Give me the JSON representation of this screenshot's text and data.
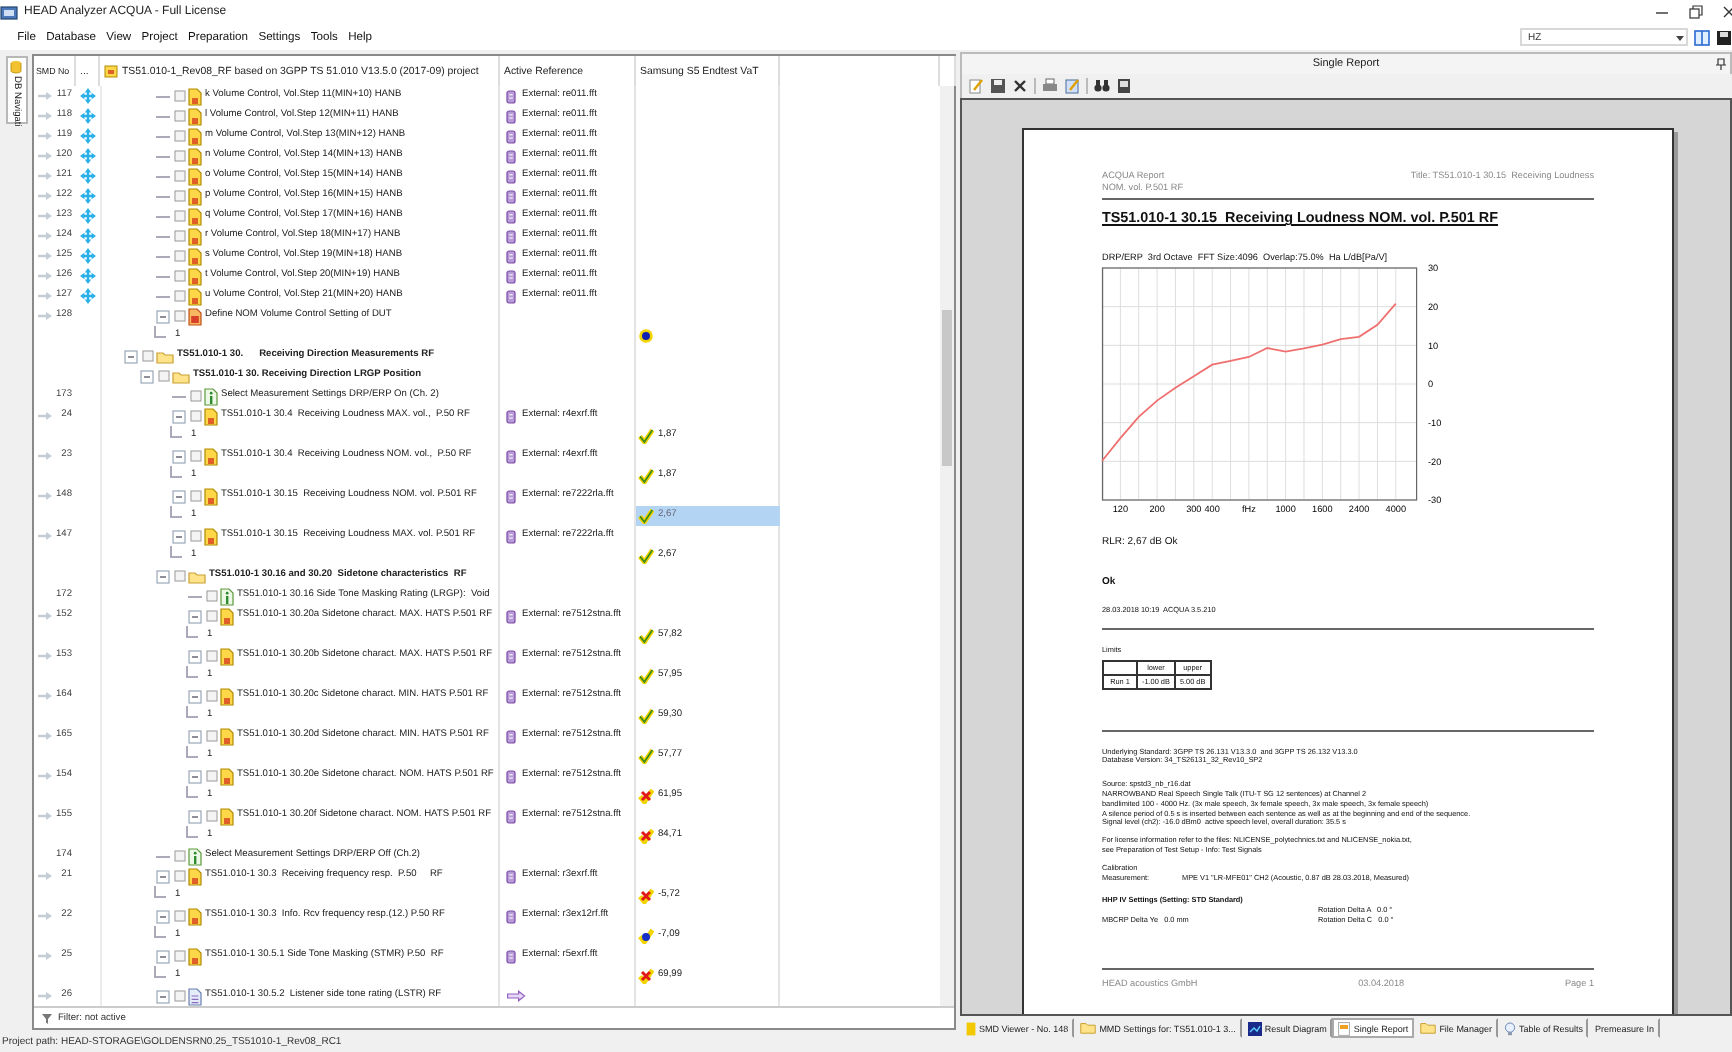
{
  "window": {
    "title": "HEAD Analyzer ACQUA - Full License"
  },
  "menu": [
    "File",
    "Database",
    "View",
    "Project",
    "Preparation",
    "Settings",
    "Tools",
    "Help"
  ],
  "unit_dropdown": {
    "value": "HZ"
  },
  "navigator": {
    "side_tab": "DB Navigati",
    "columns": [
      "SMD No",
      "...",
      "TS51.010-1_Rev08_RF based on 3GPP TS 51.010 V13.5.0 (2017-09) project",
      "Active Reference",
      "Samsung S5 Endtest VaT"
    ],
    "tree": [
      {
        "kind": "group",
        "children": [
          {
            "kind": "measurement",
            "smd": "117",
            "pointer": true,
            "flag": true,
            "checked": false,
            "label": "k Volume Control, Vol.Step 11(MIN+10) HANB",
            "reference": {
              "kind": "external",
              "text": "External: re011.fft"
            }
          },
          {
            "kind": "measurement",
            "smd": "118",
            "pointer": true,
            "flag": true,
            "checked": false,
            "label": "l Volume Control, Vol.Step 12(MIN+11) HANB",
            "reference": {
              "kind": "external",
              "text": "External: re011.fft"
            }
          },
          {
            "kind": "measurement",
            "smd": "119",
            "pointer": true,
            "flag": true,
            "checked": false,
            "label": "m Volume Control, Vol.Step 13(MIN+12) HANB",
            "reference": {
              "kind": "external",
              "text": "External: re011.fft"
            }
          },
          {
            "kind": "measurement",
            "smd": "120",
            "pointer": true,
            "flag": true,
            "checked": false,
            "label": "n Volume Control, Vol.Step 14(MIN+13) HANB",
            "reference": {
              "kind": "external",
              "text": "External: re011.fft"
            }
          },
          {
            "kind": "measurement",
            "smd": "121",
            "pointer": true,
            "flag": true,
            "checked": false,
            "label": "o Volume Control, Vol.Step 15(MIN+14) HANB",
            "reference": {
              "kind": "external",
              "text": "External: re011.fft"
            }
          },
          {
            "kind": "measurement",
            "smd": "122",
            "pointer": true,
            "flag": true,
            "checked": false,
            "label": "p Volume Control, Vol.Step 16(MIN+15) HANB",
            "reference": {
              "kind": "external",
              "text": "External: re011.fft"
            }
          },
          {
            "kind": "measurement",
            "smd": "123",
            "pointer": true,
            "flag": true,
            "checked": false,
            "label": "q Volume Control, Vol.Step 17(MIN+16) HANB",
            "reference": {
              "kind": "external",
              "text": "External: re011.fft"
            }
          },
          {
            "kind": "measurement",
            "smd": "124",
            "pointer": true,
            "flag": true,
            "checked": false,
            "label": "r Volume Control, Vol.Step 18(MIN+17) HANB",
            "reference": {
              "kind": "external",
              "text": "External: re011.fft"
            }
          },
          {
            "kind": "measurement",
            "smd": "125",
            "pointer": true,
            "flag": true,
            "checked": false,
            "label": "s Volume Control, Vol.Step 19(MIN+18) HANB",
            "reference": {
              "kind": "external",
              "text": "External: re011.fft"
            }
          },
          {
            "kind": "measurement",
            "smd": "126",
            "pointer": true,
            "flag": true,
            "checked": false,
            "label": "t Volume Control, Vol.Step 20(MIN+19) HANB",
            "reference": {
              "kind": "external",
              "text": "External: re011.fft"
            }
          },
          {
            "kind": "measurement",
            "smd": "127",
            "pointer": true,
            "flag": true,
            "checked": false,
            "label": "u Volume Control, Vol.Step 21(MIN+20) HANB",
            "reference": {
              "kind": "external",
              "text": "External: re011.fft"
            }
          },
          {
            "kind": "setup",
            "smd": "128",
            "pointer": true,
            "flag": false,
            "checked": false,
            "expanded": true,
            "label": "Define NOM Volume Control Setting of DUT",
            "children": [
              {
                "kind": "run",
                "label": "1",
                "selected": false,
                "result": {
                  "kind": "dot"
                }
              }
            ]
          }
        ]
      },
      {
        "kind": "folder",
        "expanded": true,
        "checked": false,
        "label": "TS51.010-1 30.      Receiving Direction Measurements RF",
        "children": [
          {
            "kind": "folder",
            "expanded": true,
            "checked": false,
            "label": "TS51.010-1 30. Receiving Direction LRGP Position",
            "children": [
              {
                "kind": "info",
                "smd": "173",
                "pointer": false,
                "flag": false,
                "checked": false,
                "label": "Select Measurement Settings DRP/ERP On (Ch. 2)"
              },
              {
                "kind": "measurement",
                "smd": "24",
                "pointer": true,
                "flag": false,
                "checked": false,
                "expanded": true,
                "label": "TS51.010-1 30.4  Receiving Loudness MAX. vol.,  P.50 RF",
                "reference": {
                  "kind": "external",
                  "text": "External: r4exrf.fft"
                },
                "children": [
                  {
                    "kind": "run",
                    "label": "1",
                    "selected": false,
                    "result": {
                      "kind": "pass",
                      "value": "1,87"
                    }
                  }
                ]
              },
              {
                "kind": "measurement",
                "smd": "23",
                "pointer": true,
                "flag": false,
                "checked": false,
                "expanded": true,
                "label": "TS51.010-1 30.4  Receiving Loudness NOM. vol.,  P.50 RF",
                "reference": {
                  "kind": "external",
                  "text": "External: r4exrf.fft"
                },
                "children": [
                  {
                    "kind": "run",
                    "label": "1",
                    "selected": false,
                    "result": {
                      "kind": "pass",
                      "value": "1,87"
                    }
                  }
                ]
              },
              {
                "kind": "measurement",
                "smd": "148",
                "pointer": true,
                "flag": false,
                "checked": false,
                "expanded": true,
                "label": "TS51.010-1 30.15  Receiving Loudness NOM. vol. P.501 RF",
                "reference": {
                  "kind": "external",
                  "text": "External: re7222rla.fft"
                },
                "children": [
                  {
                    "kind": "run",
                    "label": "1",
                    "selected": true,
                    "result": {
                      "kind": "pass",
                      "value": "2,67"
                    }
                  }
                ]
              },
              {
                "kind": "measurement",
                "smd": "147",
                "pointer": true,
                "flag": false,
                "checked": false,
                "expanded": true,
                "label": "TS51.010-1 30.15  Receiving Loudness MAX. vol. P.501 RF",
                "reference": {
                  "kind": "external",
                  "text": "External: re7222rla.fft"
                },
                "children": [
                  {
                    "kind": "run",
                    "label": "1",
                    "selected": false,
                    "result": {
                      "kind": "pass",
                      "value": "2,67"
                    }
                  }
                ]
              },
              {
                "kind": "folder",
                "expanded": true,
                "checked": false,
                "label": "TS51.010-1 30.16 and 30.20  Sidetone characteristics  RF",
                "children": [
                  {
                    "kind": "info",
                    "smd": "172",
                    "pointer": false,
                    "flag": false,
                    "checked": false,
                    "label": "TS51.010-1 30.16 Side Tone Masking Rating (LRGP):  Void"
                  },
                  {
                    "kind": "measurement",
                    "smd": "152",
                    "pointer": true,
                    "flag": false,
                    "checked": false,
                    "expanded": true,
                    "label": "TS51.010-1 30.20a Sidetone charact. MAX. HATS P.501 RF",
                    "reference": {
                      "kind": "external",
                      "text": "External: re7512stna.fft"
                    },
                    "children": [
                      {
                        "kind": "run",
                        "label": "1",
                        "selected": false,
                        "result": {
                          "kind": "pass",
                          "value": "57,82"
                        }
                      }
                    ]
                  },
                  {
                    "kind": "measurement",
                    "smd": "153",
                    "pointer": true,
                    "flag": false,
                    "checked": false,
                    "expanded": true,
                    "label": "TS51.010-1 30.20b Sidetone charact. MAX. HATS P.501 RF",
                    "reference": {
                      "kind": "external",
                      "text": "External: re7512stna.fft"
                    },
                    "children": [
                      {
                        "kind": "run",
                        "label": "1",
                        "selected": false,
                        "result": {
                          "kind": "pass",
                          "value": "57,95"
                        }
                      }
                    ]
                  },
                  {
                    "kind": "measurement",
                    "smd": "164",
                    "pointer": true,
                    "flag": false,
                    "checked": false,
                    "expanded": true,
                    "label": "TS51.010-1 30.20c Sidetone charact. MIN. HATS P.501 RF",
                    "reference": {
                      "kind": "external",
                      "text": "External: re7512stna.fft"
                    },
                    "children": [
                      {
                        "kind": "run",
                        "label": "1",
                        "selected": false,
                        "result": {
                          "kind": "pass",
                          "value": "59,30"
                        }
                      }
                    ]
                  },
                  {
                    "kind": "measurement",
                    "smd": "165",
                    "pointer": true,
                    "flag": false,
                    "checked": false,
                    "expanded": true,
                    "label": "TS51.010-1 30.20d Sidetone charact. MIN. HATS P.501 RF",
                    "reference": {
                      "kind": "external",
                      "text": "External: re7512stna.fft"
                    },
                    "children": [
                      {
                        "kind": "run",
                        "label": "1",
                        "selected": false,
                        "result": {
                          "kind": "pass",
                          "value": "57,77"
                        }
                      }
                    ]
                  },
                  {
                    "kind": "measurement",
                    "smd": "154",
                    "pointer": true,
                    "flag": false,
                    "checked": false,
                    "expanded": true,
                    "label": "TS51.010-1 30.20e Sidetone charact. NOM. HATS P.501 RF",
                    "reference": {
                      "kind": "external",
                      "text": "External: re7512stna.fft"
                    },
                    "children": [
                      {
                        "kind": "run",
                        "label": "1",
                        "selected": false,
                        "result": {
                          "kind": "fail",
                          "value": "61,95"
                        }
                      }
                    ]
                  },
                  {
                    "kind": "measurement",
                    "smd": "155",
                    "pointer": true,
                    "flag": false,
                    "checked": false,
                    "expanded": true,
                    "label": "TS51.010-1 30.20f Sidetone charact. NOM. HATS P.501 RF",
                    "reference": {
                      "kind": "external",
                      "text": "External: re7512stna.fft"
                    },
                    "children": [
                      {
                        "kind": "run",
                        "label": "1",
                        "selected": false,
                        "result": {
                          "kind": "fail",
                          "value": "84,71"
                        }
                      }
                    ]
                  }
                ]
              }
            ]
          },
          {
            "kind": "info",
            "smd": "174",
            "pointer": false,
            "flag": false,
            "checked": false,
            "label": "Select Measurement Settings DRP/ERP Off (Ch.2)"
          },
          {
            "kind": "measurement",
            "smd": "21",
            "pointer": true,
            "flag": false,
            "checked": false,
            "expanded": true,
            "label": "TS51.010-1 30.3  Receiving frequency resp.  P.50     RF",
            "reference": {
              "kind": "external",
              "text": "External: r3exrf.fft"
            },
            "children": [
              {
                "kind": "run",
                "label": "1",
                "selected": false,
                "result": {
                  "kind": "fail",
                  "value": "-5,72"
                }
              }
            ]
          },
          {
            "kind": "measurement",
            "smd": "22",
            "pointer": true,
            "flag": false,
            "checked": false,
            "expanded": true,
            "label": "TS51.010-1 30.3  Info. Rcv frequency resp.(12.) P.50 RF",
            "reference": {
              "kind": "external",
              "text": "External: r3ex12rf.fft"
            },
            "children": [
              {
                "kind": "run",
                "label": "1",
                "selected": false,
                "result": {
                  "kind": "info",
                  "value": "-7,09"
                }
              }
            ]
          },
          {
            "kind": "measurement",
            "smd": "25",
            "pointer": true,
            "flag": false,
            "checked": false,
            "expanded": true,
            "label": "TS51.010-1 30.5.1 Side Tone Masking (STMR) P.50  RF",
            "reference": {
              "kind": "external",
              "text": "External: r5exrf.fft"
            },
            "children": [
              {
                "kind": "run",
                "label": "1",
                "selected": false,
                "result": {
                  "kind": "fail",
                  "value": "69,99"
                }
              }
            ]
          },
          {
            "kind": "document",
            "smd": "26",
            "pointer": true,
            "flag": false,
            "checked": false,
            "expanded": true,
            "label": "TS51.010-1 30.5.2  Listener side tone rating (LSTR) RF",
            "reference": {
              "kind": "link"
            }
          }
        ]
      }
    ],
    "filter": "Filter: not active"
  },
  "status_bar": "Project path: HEAD-STORAGE\\GOLDENSRN0.25_TS51010-1_Rev08_RC1",
  "report_panel": {
    "title": "Single Report",
    "page": {
      "header_left": [
        "ACQUA Report",
        "NOM. vol. P.501 RF"
      ],
      "header_right": "Title: TS51.010-1 30.15  Receiving Loudness",
      "title": "TS51.010-1 30.15  Receiving Loudness NOM. vol. P.501 RF",
      "chart_data": {
        "type": "line",
        "title": "DRP/ERP  3rd Octave  FFT Size:4096  Overlap:75.0%  Ha L/dB[Pa/V]",
        "xlabel": "fHz",
        "categories": [
          null,
          "120",
          null,
          "200",
          null,
          "300",
          "400",
          null,
          null,
          null,
          "1000",
          null,
          "1600",
          null,
          "2400",
          null,
          "4000"
        ],
        "series": [
          {
            "color": "#f07070",
            "values": [
              -19.9,
              -14,
              -8.5,
              -4.3,
              -1,
              2,
              5,
              6,
              7,
              9.3,
              8.4,
              9.2,
              10.2,
              11.6,
              12.2,
              15.3,
              20.8
            ]
          }
        ],
        "ylim": [
          -30,
          30
        ],
        "grid": true,
        "yticks": [
          -30,
          -20,
          -10,
          0,
          10,
          20,
          30
        ]
      },
      "result": "RLR: 2,67 dB Ok",
      "verdict": "Ok",
      "timestamp": "28.03.2018 10:19  ACQUA 3.5.210",
      "limits": {
        "title": "Limits",
        "columns": [
          "lower",
          "upper"
        ],
        "rows": [
          {
            "label": "Run 1",
            "cells": [
              "-1.00 dB",
              "5.00 dB"
            ]
          }
        ]
      },
      "standard_lines": [
        "Underlying Standard: 3GPP TS 26.131 V13.3.0  and 3GPP TS 26.132 V13.3.0",
        "Database Version: 34_TS26131_32_Rev10_SP2"
      ],
      "source_lines": [
        "Source: spstd3_nb_r16.dat",
        "NARROWBAND Real Speech Single Talk (ITU-T SG 12 sentences) at Channel 2",
        "bandlimited 100 - 4000 Hz. (3x male speech, 3x female speech, 3x male speech, 3x female speech)",
        "A silence period of 0.5 s is inserted between each sentence as well as at the beginning and end of the sequence.",
        "Signal level (ch2): -16.0 dBm0  active speech level, overall duration: 35.5 s"
      ],
      "license_lines": [
        "For license information refer to the files: NLICENSE_polytechnics.txt and NLICENSE_nokia.txt,",
        "see Preparation of Test Setup - Info: Test Signals"
      ],
      "calibration": {
        "heading": "Calibration",
        "label": "Measurement:",
        "value": "MPE V1 \"LR-MFE01\" CH2 (Acoustic, 0.87 dB 28.03.2018, Measured)"
      },
      "hhp": {
        "heading": "HHP IV Settings (Setting: STD Standard)",
        "left_column": [
          "MBCRP Delta Ye   0.0 mm"
        ],
        "right_column": [
          "Rotation Delta A   0.0 °",
          "Rotation Delta C   0.0 °"
        ]
      },
      "footer": {
        "left": "HEAD acoustics GmbH",
        "center": "03.04.2018",
        "right": "Page 1"
      }
    }
  },
  "document_tabs": [
    {
      "label": "SMD Viewer - No. 148",
      "kind": "document",
      "selected": false
    },
    {
      "label": "MMD Settings for: TS51.010-1 3...",
      "kind": "folder",
      "selected": false
    },
    {
      "label": "Result Diagram",
      "kind": "chart",
      "selected": false
    },
    {
      "label": "Single Report",
      "kind": "report",
      "selected": true
    },
    {
      "label": "File Manager",
      "kind": "folder",
      "selected": false
    },
    {
      "label": "Table of Results",
      "kind": "bulb",
      "selected": false
    },
    {
      "label": "Premeasure In",
      "selected": false
    }
  ]
}
